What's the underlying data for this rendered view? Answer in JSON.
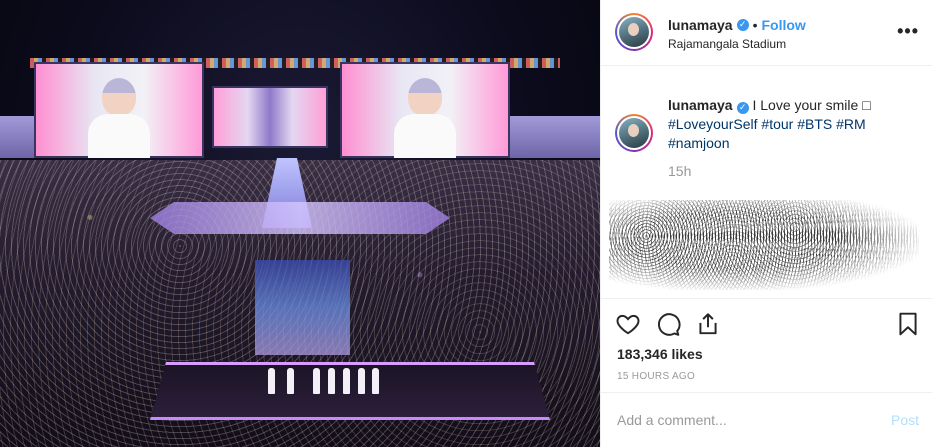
{
  "post": {
    "username": "lunamaya",
    "verified": true,
    "follow_label": "Follow",
    "dot": "•",
    "location": "Rajamangala Stadium",
    "more_label": "•••"
  },
  "caption": {
    "username": "lunamaya",
    "text": "I Love your smile",
    "emoji_glyph": "□",
    "hashtags": [
      "#LoveyourSelf",
      "#tour",
      "#BTS",
      "#RM",
      "#namjoon"
    ],
    "time": "15h"
  },
  "actions": {
    "icons": [
      "heart-icon",
      "comment-icon",
      "share-icon",
      "bookmark-icon"
    ],
    "likes": "183,346 likes",
    "timestamp": "15 HOURS AGO"
  },
  "comment": {
    "placeholder": "Add a comment...",
    "post_label": "Post"
  },
  "colors": {
    "link": "#3897f0",
    "hashtag": "#003569",
    "muted": "#999999",
    "post_disabled": "#b2dffc"
  }
}
